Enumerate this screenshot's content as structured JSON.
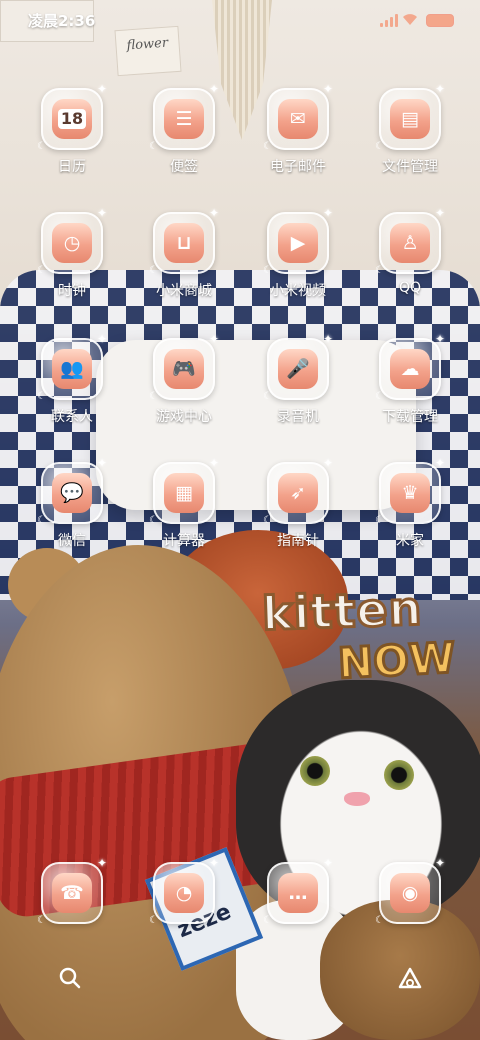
{
  "status_bar": {
    "time": "凌晨2:36",
    "accent": "#f3a88d"
  },
  "wallpaper": {
    "card_text": "flower",
    "sticker_line1": "kitten",
    "sticker_line2": "NOW",
    "tag_text": "zeze"
  },
  "grid": {
    "row1": [
      {
        "label": "日历",
        "icon": "calendar-icon",
        "glyph": "18"
      },
      {
        "label": "便签",
        "icon": "notes-icon",
        "glyph": "☰"
      },
      {
        "label": "电子邮件",
        "icon": "mail-icon",
        "glyph": "✉"
      },
      {
        "label": "文件管理",
        "icon": "file-icon",
        "glyph": "▤"
      }
    ],
    "row2": [
      {
        "label": "时钟",
        "icon": "clock-icon",
        "glyph": "◷"
      },
      {
        "label": "小米商城",
        "icon": "shopping-bag-icon",
        "glyph": "⊔"
      },
      {
        "label": "小米视频",
        "icon": "video-icon",
        "glyph": "▶"
      },
      {
        "label": "QQ",
        "icon": "penguin-icon",
        "glyph": "♙"
      }
    ],
    "row3": [
      {
        "label": "联系人",
        "icon": "contacts-icon",
        "glyph": "👥"
      },
      {
        "label": "游戏中心",
        "icon": "gamepad-icon",
        "glyph": "🎮"
      },
      {
        "label": "录音机",
        "icon": "microphone-icon",
        "glyph": "🎤"
      },
      {
        "label": "下载管理",
        "icon": "cloud-download-icon",
        "glyph": "☁"
      }
    ],
    "row4": [
      {
        "label": "微信",
        "icon": "chat-bubbles-icon",
        "glyph": "💬"
      },
      {
        "label": "计算器",
        "icon": "calculator-icon",
        "glyph": "▦"
      },
      {
        "label": "指南针",
        "icon": "compass-icon",
        "glyph": "➶"
      },
      {
        "label": "米家",
        "icon": "crown-home-icon",
        "glyph": "♛"
      }
    ]
  },
  "dock": [
    {
      "icon": "phone-icon",
      "glyph": "☎"
    },
    {
      "icon": "browser-icon",
      "glyph": "◔"
    },
    {
      "icon": "messages-icon",
      "glyph": "…"
    },
    {
      "icon": "camera-icon",
      "glyph": "◉"
    }
  ],
  "bottom_bar": {
    "left_icon": "search-icon",
    "right_icon": "assistant-icon"
  }
}
